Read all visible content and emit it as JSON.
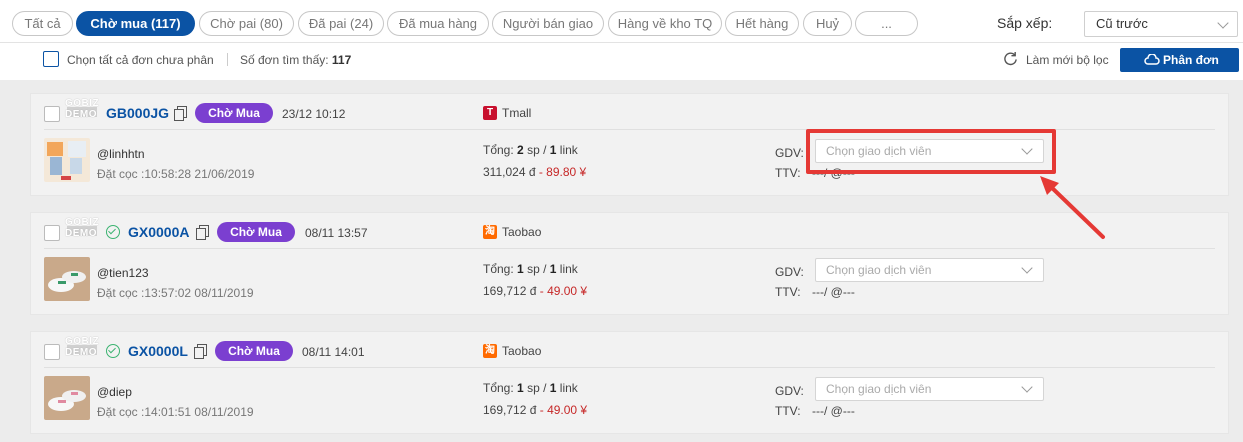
{
  "tabs": [
    {
      "label": "Tất cả",
      "active": false
    },
    {
      "label": "Chờ mua (117)",
      "active": true
    },
    {
      "label": "Chờ pai (80)",
      "active": false
    },
    {
      "label": "Đã pai (24)",
      "active": false
    },
    {
      "label": "Đã mua hàng",
      "active": false
    },
    {
      "label": "Người bán giao",
      "active": false
    },
    {
      "label": "Hàng về kho TQ",
      "active": false
    },
    {
      "label": "Hết hàng",
      "active": false
    },
    {
      "label": "Huỷ",
      "active": false
    },
    {
      "label": "...",
      "active": false
    }
  ],
  "sort": {
    "label": "Sắp xếp:",
    "value": "Cũ trước"
  },
  "toolbar": {
    "select_all_label": "Chọn tất cả đơn chưa phân",
    "found_label": "Số đơn tìm thấy:",
    "found_count": "117",
    "refresh_label": "Làm mới bộ lọc",
    "split_label": "Phân đơn"
  },
  "watermark": "GOBIZ DEMO",
  "orders": [
    {
      "code": "GB000JG",
      "status": "Chờ Mua",
      "datetime": "23/12 10:12",
      "shop": "Tmall",
      "shop_icon": "T",
      "shop_color": "#c8102e",
      "buyer": "@linhhtn",
      "deposit": "Đặt cọc :10:58:28 21/06/2019",
      "total_prefix": "Tổng:",
      "sp": "2",
      "sp_label": "sp /",
      "links": "1",
      "link_label": "link",
      "vnd": "311,024 đ",
      "cny": "- 89.80 ¥",
      "gdv_label": "GDV:",
      "gdv_placeholder": "Chọn giao dịch viên",
      "ttv_label": "TTV:",
      "ttv_value": "---/ @---",
      "verified": false
    },
    {
      "code": "GX0000A",
      "status": "Chờ Mua",
      "datetime": "08/11 13:57",
      "shop": "Taobao",
      "shop_icon": "淘",
      "shop_color": "#ff6a00",
      "buyer": "@tien123",
      "deposit": "Đặt cọc :13:57:02 08/11/2019",
      "total_prefix": "Tổng:",
      "sp": "1",
      "sp_label": "sp /",
      "links": "1",
      "link_label": "link",
      "vnd": "169,712 đ",
      "cny": "- 49.00 ¥",
      "gdv_label": "GDV:",
      "gdv_placeholder": "Chọn giao dịch viên",
      "ttv_label": "TTV:",
      "ttv_value": "---/ @---",
      "verified": true
    },
    {
      "code": "GX0000L",
      "status": "Chờ Mua",
      "datetime": "08/11 14:01",
      "shop": "Taobao",
      "shop_icon": "淘",
      "shop_color": "#ff6a00",
      "buyer": "@diep",
      "deposit": "Đặt cọc :14:01:51 08/11/2019",
      "total_prefix": "Tổng:",
      "sp": "1",
      "sp_label": "sp /",
      "links": "1",
      "link_label": "link",
      "vnd": "169,712 đ",
      "cny": "- 49.00 ¥",
      "gdv_label": "GDV:",
      "gdv_placeholder": "Chọn giao dịch viên",
      "ttv_label": "TTV:",
      "ttv_value": "---/ @---",
      "verified": true
    }
  ],
  "colors": {
    "primary": "#0b53a4",
    "badge": "#7b3fd0",
    "highlight": "#e53935",
    "cny": "#c62828",
    "verified": "#3cb371"
  }
}
